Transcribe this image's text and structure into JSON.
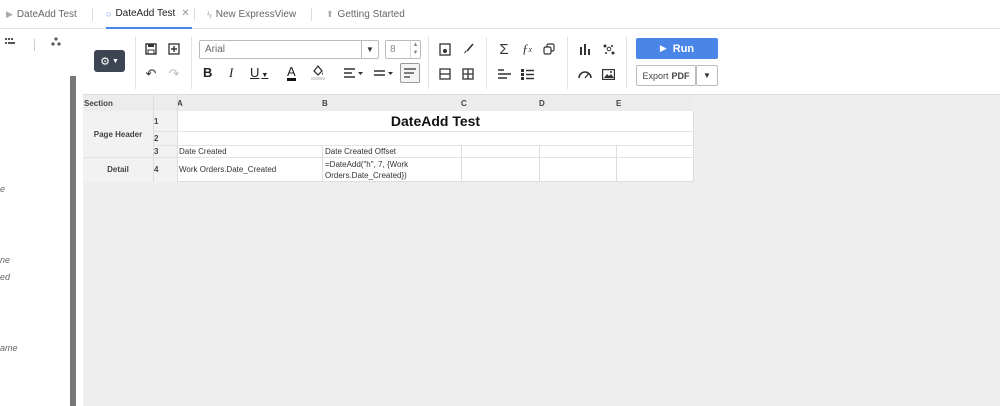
{
  "tabs": [
    {
      "label": "DateAdd Test",
      "icon": "play-icon",
      "active": false
    },
    {
      "label": "DateAdd Test",
      "icon": "circle-icon",
      "active": true
    },
    {
      "label": "New ExpressView",
      "icon": "lightning-icon",
      "active": false
    },
    {
      "label": "Getting Started",
      "icon": "up-arrow-icon",
      "active": false
    }
  ],
  "sidebar": {
    "fragments": [
      "e",
      "ne",
      "ed",
      "ame"
    ]
  },
  "toolbar": {
    "font_family": "Arial",
    "font_size": "8",
    "run_label": "Run",
    "export_label": "Export",
    "export_format": "PDF"
  },
  "grid": {
    "section_header": "Section",
    "columns": [
      "A",
      "B",
      "C",
      "D",
      "E"
    ],
    "sections": [
      {
        "name": "Page Header",
        "rows": [
          "1",
          "2",
          "3"
        ]
      },
      {
        "name": "Detail",
        "rows": [
          "4"
        ]
      }
    ],
    "title_text": "DateAdd Test",
    "row3": {
      "a": "Date Created",
      "b": "Date Created Offset"
    },
    "row4": {
      "a": "Work Orders.Date_Created",
      "b": "=DateAdd(\"h\", 7, {Work Orders.Date_Created})"
    }
  },
  "colors": {
    "accent": "#4a86e8",
    "gear_button": "#3d4452",
    "canvas": "#eeeeee"
  }
}
